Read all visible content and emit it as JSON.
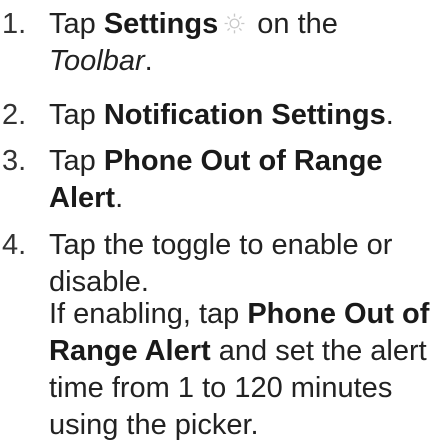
{
  "steps": [
    {
      "number": "1.",
      "prefix": "Tap",
      "bold": "Settings",
      "icon": "settings-gear-icon",
      "after_icon": "on the",
      "italic": "Toolbar",
      "end": "."
    },
    {
      "number": "2.",
      "prefix": "Tap",
      "bold": "Notification Settings",
      "end": "."
    },
    {
      "number": "3.",
      "prefix": "Tap",
      "bold_line1": "Phone Out of Range",
      "bold_line2": "Alert",
      "end": "."
    },
    {
      "number": "4.",
      "line1": "Tap the toggle to enable or",
      "line2": "disable."
    }
  ],
  "note": {
    "prefix": "If enabling, tap",
    "bold_line1": "Phone Out of",
    "bold_line2": "Range Alert",
    "line2_rest": "and set the alert",
    "line3": "time from 1 to 120 minutes",
    "line4": "using the picker."
  },
  "colors": {
    "text": "#222222",
    "icon": "#c8c8c8"
  }
}
